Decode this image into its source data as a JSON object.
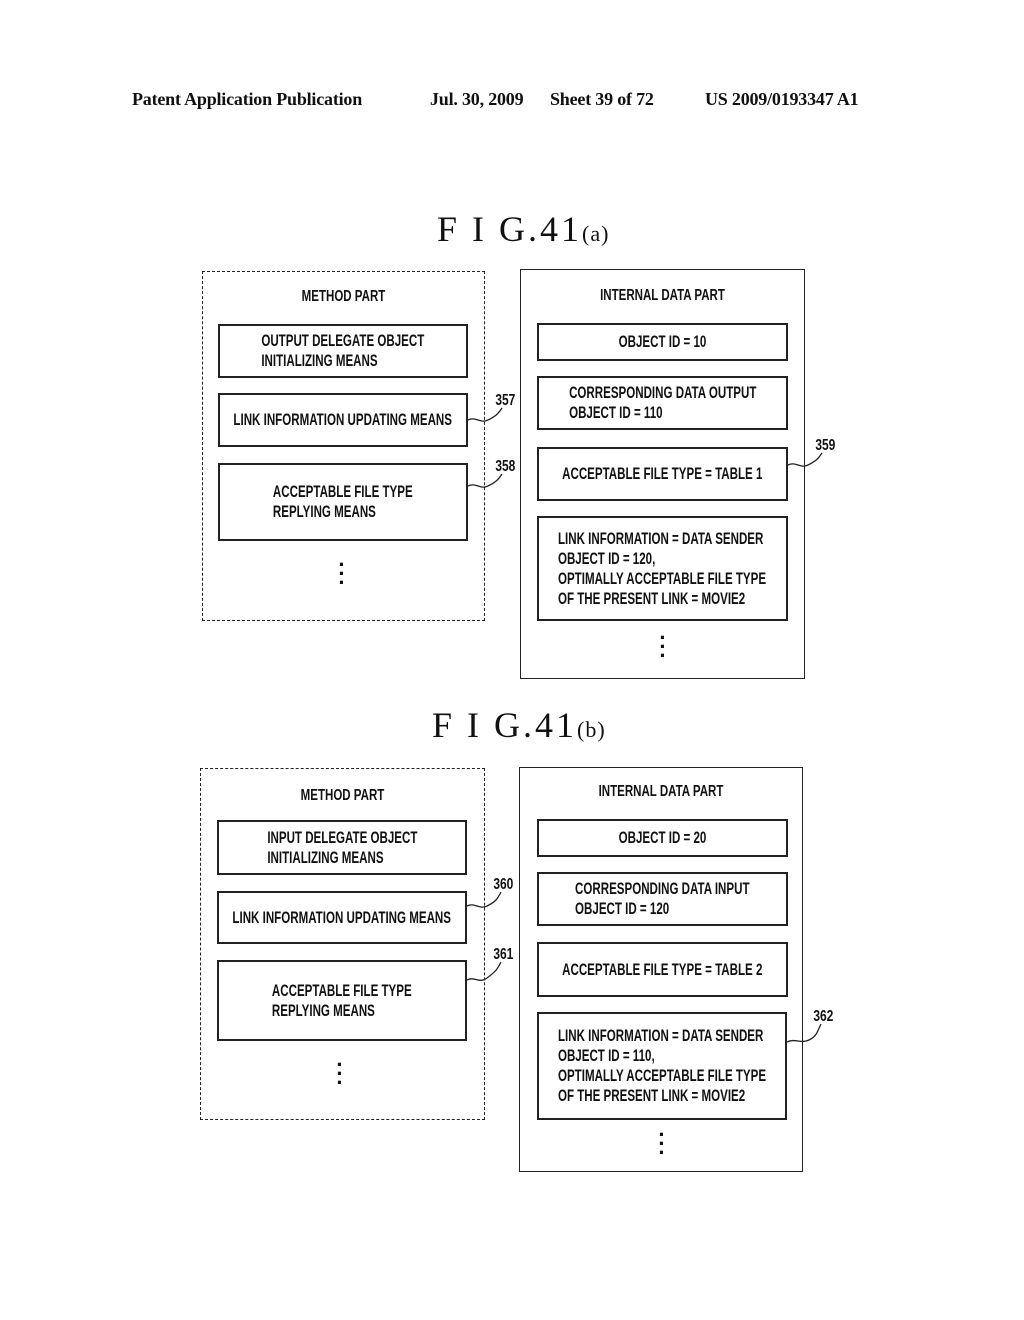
{
  "header": {
    "publication": "Patent Application Publication",
    "date": "Jul. 30, 2009",
    "sheet": "Sheet 39 of 72",
    "number": "US 2009/0193347 A1"
  },
  "figures": [
    {
      "title": "F I G.41",
      "suffix": "(a)",
      "method_part": {
        "title": "METHOD PART",
        "items": [
          "OUTPUT DELEGATE OBJECT\nINITIALIZING MEANS",
          "LINK INFORMATION UPDATING MEANS",
          "ACCEPTABLE FILE TYPE\nREPLYING MEANS"
        ],
        "continuation": "⋮",
        "refs": [
          "357",
          "358"
        ]
      },
      "internal_data_part": {
        "title": "INTERNAL DATA PART",
        "items": [
          "OBJECT ID = 10",
          "CORRESPONDING DATA OUTPUT\nOBJECT ID = 110",
          "ACCEPTABLE FILE TYPE = TABLE 1",
          "LINK INFORMATION = DATA SENDER\nOBJECT ID = 120,\nOPTIMALLY ACCEPTABLE FILE TYPE\nOF THE PRESENT LINK = MOVIE2"
        ],
        "continuation": "⋮",
        "refs": [
          "359"
        ]
      }
    },
    {
      "title": "F I G.41",
      "suffix": "(b)",
      "method_part": {
        "title": "METHOD PART",
        "items": [
          "INPUT DELEGATE OBJECT\nINITIALIZING MEANS",
          "LINK INFORMATION UPDATING MEANS",
          "ACCEPTABLE FILE TYPE\nREPLYING MEANS"
        ],
        "continuation": "⋮",
        "refs": [
          "360",
          "361"
        ]
      },
      "internal_data_part": {
        "title": "INTERNAL DATA PART",
        "items": [
          "OBJECT ID = 20",
          "CORRESPONDING DATA INPUT\nOBJECT ID = 120",
          "ACCEPTABLE FILE TYPE = TABLE 2",
          "LINK INFORMATION = DATA SENDER\nOBJECT ID = 110,\nOPTIMALLY ACCEPTABLE FILE TYPE\nOF THE PRESENT LINK = MOVIE2"
        ],
        "continuation": "⋮",
        "refs": [
          "362"
        ]
      }
    }
  ]
}
